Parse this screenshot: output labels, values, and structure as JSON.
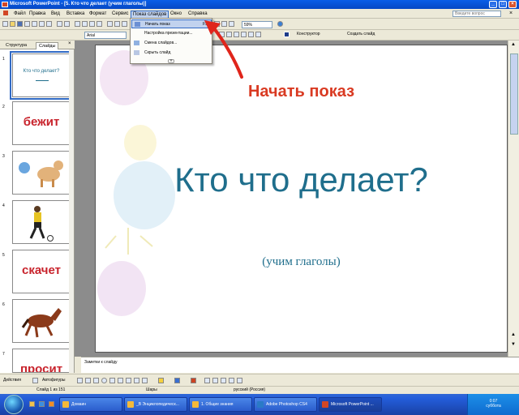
{
  "window": {
    "title": "Microsoft PowerPoint - [5. Кто что делает (учим глаголы)]",
    "buttons": [
      "_",
      "□",
      "×"
    ]
  },
  "menubar": {
    "items": [
      "Файл",
      "Правка",
      "Вид",
      "Вставка",
      "Формат",
      "Сервис",
      "Показ слайдов",
      "Окно",
      "Справка"
    ],
    "ask_placeholder": "Введите вопрос"
  },
  "toolbar": {
    "zoom": "59%",
    "font": "Arial",
    "designer": "Конструктор",
    "new_slide": "Создать слайд"
  },
  "dropdown_menu": {
    "items": [
      {
        "label": "Начать показ",
        "shortcut": "F5",
        "highlighted": true,
        "icon": "slideshow-icon"
      },
      {
        "label": "Настройка презентации...",
        "shortcut": "",
        "highlighted": false,
        "icon": ""
      },
      {
        "label": "Смена слайдов...",
        "shortcut": "",
        "highlighted": false,
        "icon": "transition-icon"
      },
      {
        "label": "Скрыть слайд",
        "shortcut": "",
        "highlighted": false,
        "icon": "hide-slide-icon"
      }
    ]
  },
  "leftpane": {
    "tabs": [
      "Структура",
      "Слайды"
    ],
    "thumbnails": [
      {
        "num": "1",
        "text": "Кто что делает?",
        "kind": "title"
      },
      {
        "num": "2",
        "text": "бежит",
        "kind": "word"
      },
      {
        "num": "3",
        "text": "",
        "kind": "dog"
      },
      {
        "num": "4",
        "text": "",
        "kind": "runner"
      },
      {
        "num": "5",
        "text": "скачет",
        "kind": "word"
      },
      {
        "num": "6",
        "text": "",
        "kind": "horse"
      },
      {
        "num": "7",
        "text": "просит",
        "kind": "word"
      }
    ]
  },
  "slide": {
    "annotation": "Начать показ",
    "title": "Кто что делает?",
    "subtitle": "(учим глаголы)",
    "annotation_color": "#d93a22",
    "title_color": "#1f6e8c"
  },
  "notes": {
    "placeholder": "Заметки к слайду"
  },
  "drawbar": {
    "actions": "Действия",
    "autoshapes": "Автофигуры"
  },
  "statusbar": {
    "slide": "Слайд 1 из 151",
    "design": "Шары",
    "language": "русский (Россия)"
  },
  "taskbar": {
    "tasks": [
      "Домаин",
      "_В Энциклопедическ...",
      "1. Общие знания",
      "Adobe Photoshop CS4",
      "Microsoft PowerPoint ..."
    ],
    "time": "0:07",
    "day": "суббота"
  }
}
